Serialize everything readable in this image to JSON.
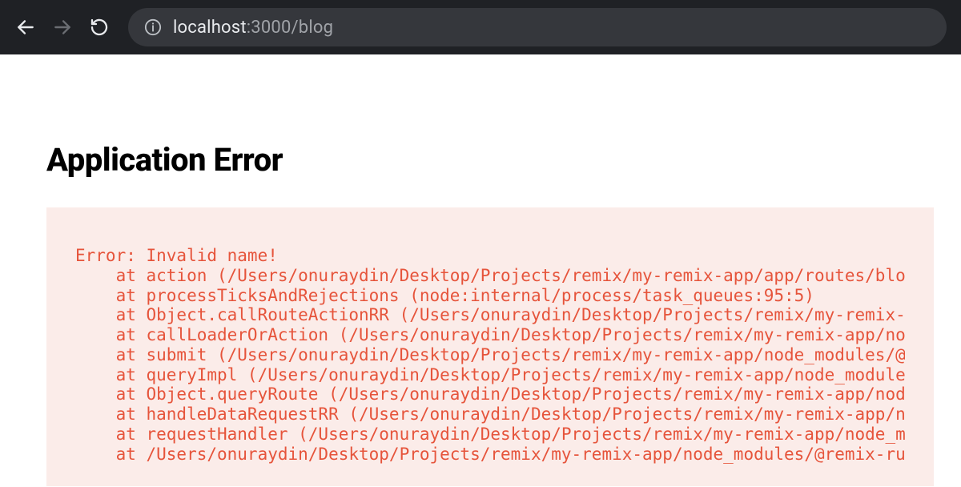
{
  "browser": {
    "url_host": "localhost",
    "url_port_path": ":3000/blog"
  },
  "page": {
    "title": "Application Error"
  },
  "error": {
    "message": "Error: Invalid name!",
    "stack": [
      "    at action (/Users/onuraydin/Desktop/Projects/remix/my-remix-app/app/routes/blog",
      "    at processTicksAndRejections (node:internal/process/task_queues:95:5)",
      "    at Object.callRouteActionRR (/Users/onuraydin/Desktop/Projects/remix/my-remix-app",
      "    at callLoaderOrAction (/Users/onuraydin/Desktop/Projects/remix/my-remix-app/node_",
      "    at submit (/Users/onuraydin/Desktop/Projects/remix/my-remix-app/node_modules/@rem",
      "    at queryImpl (/Users/onuraydin/Desktop/Projects/remix/my-remix-app/node_modules/@",
      "    at Object.queryRoute (/Users/onuraydin/Desktop/Projects/remix/my-remix-app/node_m",
      "    at handleDataRequestRR (/Users/onuraydin/Desktop/Projects/remix/my-remix-app/node",
      "    at requestHandler (/Users/onuraydin/Desktop/Projects/remix/my-remix-app/node_modu",
      "    at /Users/onuraydin/Desktop/Projects/remix/my-remix-app/node_modules/@remix-run/e"
    ]
  }
}
